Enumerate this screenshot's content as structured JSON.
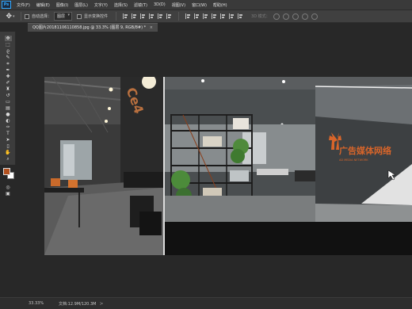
{
  "menubar": {
    "app_logo": "Ps",
    "items": [
      "文件(F)",
      "编辑(E)",
      "图像(I)",
      "图层(L)",
      "文字(Y)",
      "选择(S)",
      "滤镜(T)",
      "3D(D)",
      "视图(V)",
      "窗口(W)",
      "帮助(H)"
    ]
  },
  "options": {
    "auto_select_label": "自动选择：",
    "auto_select_value": "图层",
    "show_transform_label": "显示变换控件",
    "mode3d_label": "3D 模式："
  },
  "document": {
    "tab_title": "QQ图片20181106110858.jpg @ 33.3% (图层 9, RGB/8#) *",
    "close_glyph": "×"
  },
  "status": {
    "zoom": "33.33%",
    "doc_size": "文档:12.9M/120.3M",
    "arrow": ">"
  },
  "image_content": {
    "sign_main": "广告媒体网络",
    "sign_sub": "AD MEDIA NETWORK"
  },
  "colors": {
    "foreground": "#b3511f",
    "background": "#ffffff",
    "sign_orange": "#d8652a"
  },
  "icons": {
    "move_tool": "move-icon",
    "marquee": "rect-marquee-icon",
    "lasso": "lasso-icon",
    "magic_wand": "quick-select-icon",
    "crop": "crop-icon",
    "eyedropper": "eyedropper-icon",
    "brush": "brush-icon",
    "zoom": "zoom-icon"
  }
}
